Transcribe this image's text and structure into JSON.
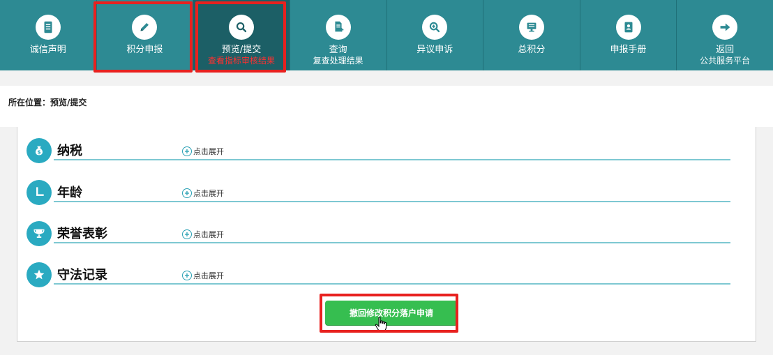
{
  "nav": {
    "items": [
      {
        "label": "诚信声明",
        "sublabel": "",
        "icon": "document-icon"
      },
      {
        "label": "积分申报",
        "sublabel": "",
        "icon": "pencil-icon"
      },
      {
        "label": "预览/提交",
        "sublabel": "查看指标审核结果",
        "icon": "search-icon"
      },
      {
        "label": "查询",
        "sublabel": "复查处理结果",
        "icon": "file-add-icon"
      },
      {
        "label": "异议申诉",
        "sublabel": "",
        "icon": "zoom-in-icon"
      },
      {
        "label": "总积分",
        "sublabel": "",
        "icon": "monitor-icon"
      },
      {
        "label": "申报手册",
        "sublabel": "",
        "icon": "contact-book-icon"
      },
      {
        "label": "返回",
        "sublabel": "公共服务平台",
        "icon": "arrow-right-icon"
      }
    ]
  },
  "breadcrumb": {
    "prefix": "所在位置：",
    "current": "预览/提交"
  },
  "sections": [
    {
      "title": "纳税",
      "icon": "money-bag-icon",
      "expand": "点击展开"
    },
    {
      "title": "年龄",
      "icon": "clock-icon",
      "expand": "点击展开"
    },
    {
      "title": "荣誉表彰",
      "icon": "trophy-icon",
      "expand": "点击展开"
    },
    {
      "title": "守法记录",
      "icon": "star-icon",
      "expand": "点击展开"
    }
  ],
  "action": {
    "withdraw_label": "撤回修改积分落户申请"
  },
  "colors": {
    "nav_bg": "#2d8a93",
    "nav_active": "#1c5f66",
    "accent": "#2aaac1",
    "button": "#36be50",
    "highlight": "#e8211f"
  }
}
